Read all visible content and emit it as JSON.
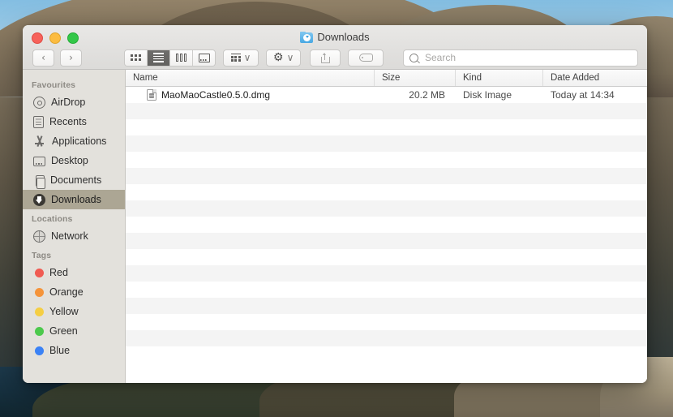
{
  "window": {
    "title": "Downloads",
    "title_icon": "downloads-folder-icon",
    "traffic_lights": [
      {
        "name": "close",
        "color": "#f7625a"
      },
      {
        "name": "minimize",
        "color": "#fcbc40"
      },
      {
        "name": "zoom",
        "color": "#33c748"
      }
    ]
  },
  "toolbar": {
    "back_label": "‹",
    "forward_label": "›",
    "view_modes": [
      {
        "name": "icon-view",
        "active": false
      },
      {
        "name": "list-view",
        "active": true
      },
      {
        "name": "column-view",
        "active": false
      },
      {
        "name": "gallery-view",
        "active": false
      }
    ],
    "group_label": "∨",
    "action_label": "⚙",
    "action_caret": "∨",
    "share_name": "share-button",
    "tag_name": "tag-button"
  },
  "search": {
    "placeholder": "Search",
    "value": ""
  },
  "sidebar": {
    "sections": [
      {
        "heading": "Favourites",
        "items": [
          {
            "label": "AirDrop",
            "icon": "airdrop-icon",
            "selected": false
          },
          {
            "label": "Recents",
            "icon": "recents-icon",
            "selected": false
          },
          {
            "label": "Applications",
            "icon": "applications-icon",
            "selected": false
          },
          {
            "label": "Desktop",
            "icon": "desktop-icon",
            "selected": false
          },
          {
            "label": "Documents",
            "icon": "documents-icon",
            "selected": false
          },
          {
            "label": "Downloads",
            "icon": "downloads-icon",
            "selected": true
          }
        ]
      },
      {
        "heading": "Locations",
        "items": [
          {
            "label": "Network",
            "icon": "network-icon",
            "selected": false
          }
        ]
      },
      {
        "heading": "Tags",
        "items": [
          {
            "label": "Red",
            "icon": "tag-dot-icon",
            "color": "#f05b52",
            "selected": false
          },
          {
            "label": "Orange",
            "icon": "tag-dot-icon",
            "color": "#f5943a",
            "selected": false
          },
          {
            "label": "Yellow",
            "icon": "tag-dot-icon",
            "color": "#f5ce43",
            "selected": false
          },
          {
            "label": "Green",
            "icon": "tag-dot-icon",
            "color": "#4cc94c",
            "selected": false
          },
          {
            "label": "Blue",
            "icon": "tag-dot-icon",
            "color": "#3b82f5",
            "selected": false
          }
        ]
      }
    ]
  },
  "file_list": {
    "columns": [
      "Name",
      "Size",
      "Kind",
      "Date Added"
    ],
    "rows": [
      {
        "name": "MaoMaoCastle0.5.0.dmg",
        "size": "20.2 MB",
        "kind": "Disk Image",
        "date_added": "Today at 14:34",
        "icon": "disk-image-file-icon"
      }
    ],
    "empty_row_count": 16
  },
  "colors": {
    "selection": "#aca694",
    "sidebar_bg": "#e3e1dc",
    "row_alt": "#f4f4f4"
  }
}
